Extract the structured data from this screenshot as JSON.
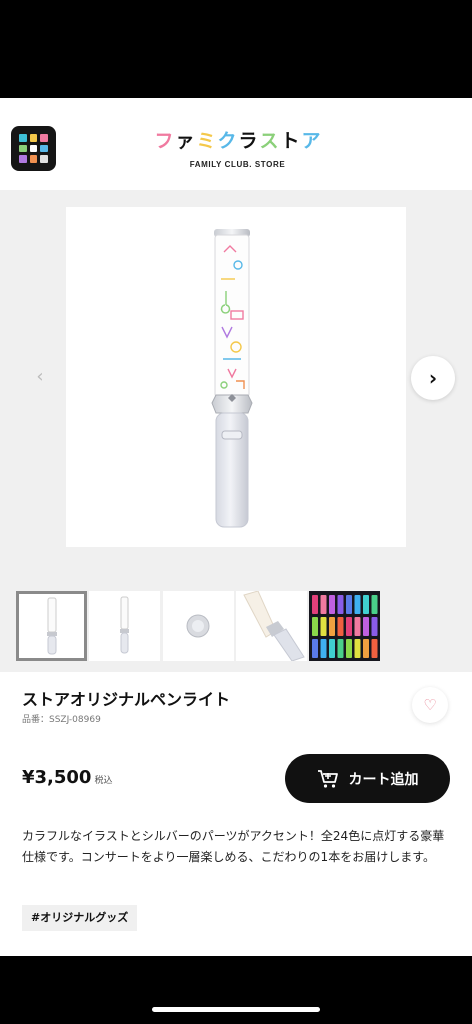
{
  "header": {
    "menu_icon": "grid-menu-icon",
    "logo_chars": [
      {
        "ch": "フ",
        "color": "#f07aa0"
      },
      {
        "ch": "ァ",
        "color": "#111111"
      },
      {
        "ch": "ミ",
        "color": "#f4c84a"
      },
      {
        "ch": "ク",
        "color": "#58b8e8"
      },
      {
        "ch": "ラ",
        "color": "#111111"
      },
      {
        "ch": "ス",
        "color": "#8bd07a"
      },
      {
        "ch": "ト",
        "color": "#111111"
      },
      {
        "ch": "ア",
        "color": "#58b8e8"
      }
    ],
    "logo_sub": "FAMILY CLUB. STORE"
  },
  "gallery": {
    "prev_icon": "chevron-left-icon",
    "next_icon": "chevron-right-icon",
    "prev_glyph": "‹",
    "next_glyph": "›",
    "thumbnail_count": 5,
    "selected_index": 0
  },
  "product": {
    "title": "ストアオリジナルペンライト",
    "sku": "品番：SSZJ-08969",
    "price": "¥3,500",
    "tax_label": "税込",
    "cart_label": "カート追加",
    "fav_icon": "heart-icon",
    "fav_glyph": "♡",
    "description": "カラフルなイラストとシルバーのパーツがアクセント！全24色に点灯する豪華仕様です。コンサートをより一層楽しめる、こだわりの1本をお届けします。",
    "tag": "#オリジナルグッズ"
  },
  "colors": {
    "accent": "#111111",
    "gallery_bg": "#f0f0f0",
    "menu_squares": [
      "#3fc1d8",
      "#f4c84a",
      "#f07aa0",
      "#8bd07a",
      "#ffffff",
      "#58b8e8",
      "#b07ae0",
      "#f09050",
      "#e0e0e0"
    ]
  }
}
